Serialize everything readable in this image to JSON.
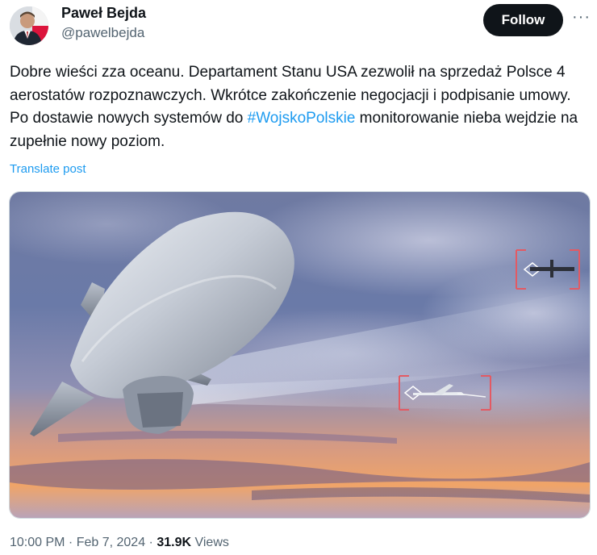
{
  "author": {
    "name": "Paweł Bejda",
    "handle": "@pawelbejda"
  },
  "follow_label": "Follow",
  "more_label": "···",
  "post": {
    "text_before": "Dobre wieści zza oceanu. Departament Stanu USA zezwolił na sprzedaż Polsce 4 aerostatów rozpoznawczych. Wkrótce zakończenie negocjacji i podpisanie umowy. Po dostawie nowych systemów do ",
    "hashtag": "#WojskoPolskie",
    "text_after": " monitorowanie nieba wejdzie na zupełnie nowy poziom."
  },
  "translate_label": "Translate post",
  "meta": {
    "time": "10:00 PM",
    "separator": " · ",
    "date": "Feb 7, 2024",
    "views_count": "31.9K",
    "views_label": " Views"
  },
  "colors": {
    "link": "#1d9bf0",
    "follow_bg": "#0f1419",
    "secondary_text": "#536471"
  }
}
